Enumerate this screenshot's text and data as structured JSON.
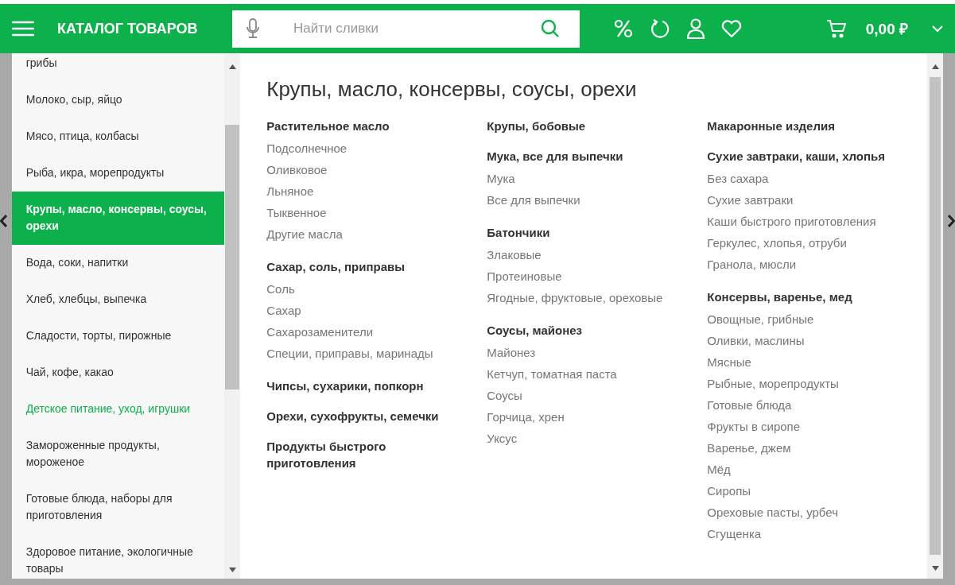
{
  "header": {
    "catalog_title": "КАТАЛОГ ТОВАРОВ",
    "search": {
      "placeholder": "Найти сливки"
    },
    "cart_total": "0,00 ₽"
  },
  "sidebar": {
    "items": [
      {
        "label": "грибы",
        "selected": false,
        "accent": false
      },
      {
        "label": "Молоко, сыр, яйцо",
        "selected": false,
        "accent": false
      },
      {
        "label": "Мясо, птица, колбасы",
        "selected": false,
        "accent": false
      },
      {
        "label": "Рыба, икра, морепродукты",
        "selected": false,
        "accent": false
      },
      {
        "label": "Крупы, масло, консервы, соусы, орехи",
        "selected": true,
        "accent": false
      },
      {
        "label": "Вода, соки, напитки",
        "selected": false,
        "accent": false
      },
      {
        "label": "Хлеб, хлебцы, выпечка",
        "selected": false,
        "accent": false
      },
      {
        "label": "Сладости, торты, пирожные",
        "selected": false,
        "accent": false
      },
      {
        "label": "Чай, кофе, какао",
        "selected": false,
        "accent": false
      },
      {
        "label": "Детское питание, уход, игрушки",
        "selected": false,
        "accent": true
      },
      {
        "label": "Замороженные продукты, мороженое",
        "selected": false,
        "accent": false
      },
      {
        "label": "Готовые блюда, наборы для приготовления",
        "selected": false,
        "accent": false
      },
      {
        "label": "Здоровое питание, экологичные товары",
        "selected": false,
        "accent": false
      }
    ]
  },
  "category": {
    "title": "Крупы, масло, консервы, соусы, орехи",
    "columns": [
      [
        {
          "title": "Растительное масло",
          "items": [
            "Подсолнечное",
            "Оливковое",
            "Льняное",
            "Тыквенное",
            "Другие масла"
          ]
        },
        {
          "title": "Сахар, соль, приправы",
          "items": [
            "Соль",
            "Сахар",
            "Сахарозаменители",
            "Специи, приправы, маринады"
          ]
        },
        {
          "title": "Чипсы, сухарики, попкорн"
        },
        {
          "title": "Орехи, сухофрукты, семечки"
        },
        {
          "title": "Продукты быстрого приготовления"
        }
      ],
      [
        {
          "title": "Крупы, бобовые"
        },
        {
          "title": "Мука, все для выпечки",
          "items": [
            "Мука",
            "Все для выпечки"
          ]
        },
        {
          "title": "Батончики",
          "items": [
            "Злаковые",
            "Протеиновые",
            "Ягодные, фруктовые, ореховые"
          ]
        },
        {
          "title": "Соусы, майонез",
          "items": [
            "Майонез",
            "Кетчуп, томатная паста",
            "Соусы",
            "Горчица, хрен",
            "Уксус"
          ]
        }
      ],
      [
        {
          "title": "Макаронные изделия"
        },
        {
          "title": "Сухие завтраки, каши, хлопья",
          "items": [
            "Без сахара",
            "Сухие завтраки",
            "Каши быстрого приготовления",
            "Геркулес, хлопья, отруби",
            "Гранола, мюсли"
          ]
        },
        {
          "title": "Консервы, варенье, мед",
          "items": [
            "Овощные, грибные",
            "Оливки, маслины",
            "Мясные",
            "Рыбные, морепродукты",
            "Готовые блюда",
            "Фрукты в сиропе",
            "Варенье, джем",
            "Мёд",
            "Сиропы",
            "Ореховые пасты, урбеч",
            "Сгущенка"
          ]
        }
      ]
    ]
  }
}
